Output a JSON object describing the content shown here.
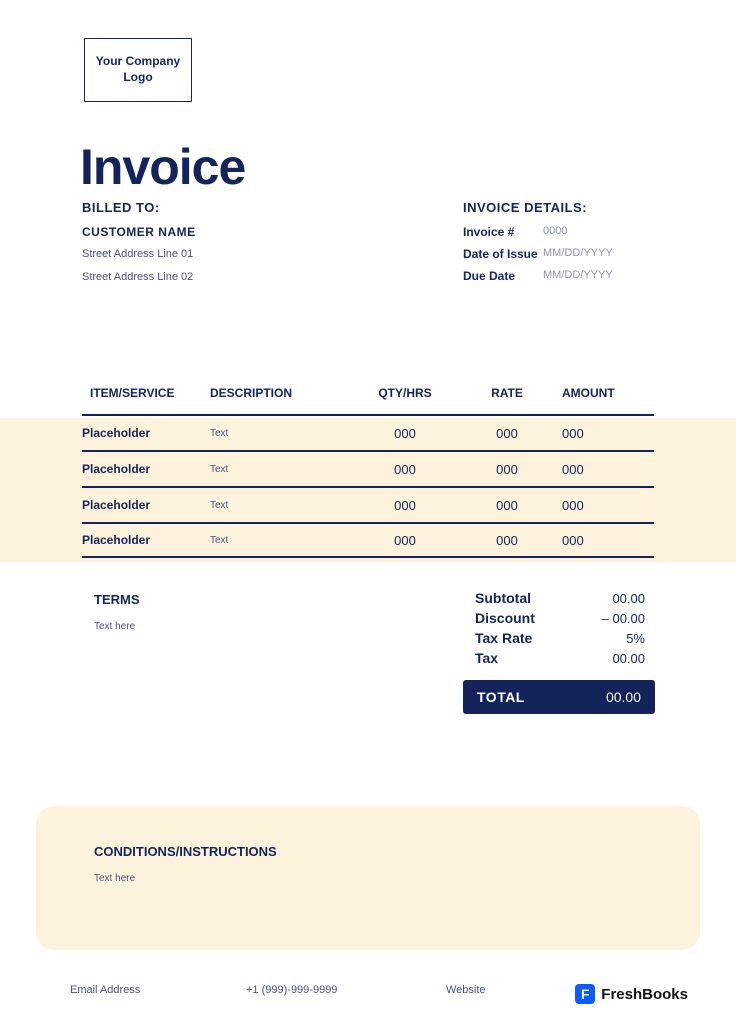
{
  "logo_text": "Your Company Logo",
  "title": "Invoice",
  "billed_to": {
    "label": "BILLED TO:",
    "customer_name": "CUSTOMER NAME",
    "address_line_1": "Street Address Line 01",
    "address_line_2": "Street Address Line 02"
  },
  "invoice_details": {
    "label": "INVOICE DETAILS:",
    "number_label": "Invoice #",
    "number_value": "0000",
    "date_of_issue_label": "Date of Issue",
    "date_of_issue_value": "MM/DD/YYYY",
    "due_date_label": "Due Date",
    "due_date_value": "MM/DD/YYYY"
  },
  "table": {
    "headers": {
      "item": "ITEM/SERVICE",
      "description": "DESCRIPTION",
      "qty": "QTY/HRS",
      "rate": "RATE",
      "amount": "AMOUNT"
    },
    "rows": [
      {
        "item": "Placeholder",
        "description": "Text",
        "qty": "000",
        "rate": "000",
        "amount": "000"
      },
      {
        "item": "Placeholder",
        "description": "Text",
        "qty": "000",
        "rate": "000",
        "amount": "000"
      },
      {
        "item": "Placeholder",
        "description": "Text",
        "qty": "000",
        "rate": "000",
        "amount": "000"
      },
      {
        "item": "Placeholder",
        "description": "Text",
        "qty": "000",
        "rate": "000",
        "amount": "000"
      }
    ]
  },
  "terms": {
    "label": "TERMS",
    "text": "Text here"
  },
  "totals": {
    "subtotal_label": "Subtotal",
    "subtotal_value": "00.00",
    "discount_label": "Discount",
    "discount_value": "– 00.00",
    "tax_rate_label": "Tax Rate",
    "tax_rate_value": "5%",
    "tax_label": "Tax",
    "tax_value": "00.00",
    "total_label": "TOTAL",
    "total_value": "00.00"
  },
  "conditions": {
    "label": "CONDITIONS/INSTRUCTIONS",
    "text": "Text here"
  },
  "footer": {
    "email": "Email Address",
    "phone": "+1 (999)-999-9999",
    "website": "Website"
  },
  "freshbooks": {
    "icon": "F",
    "text": "FreshBooks"
  }
}
